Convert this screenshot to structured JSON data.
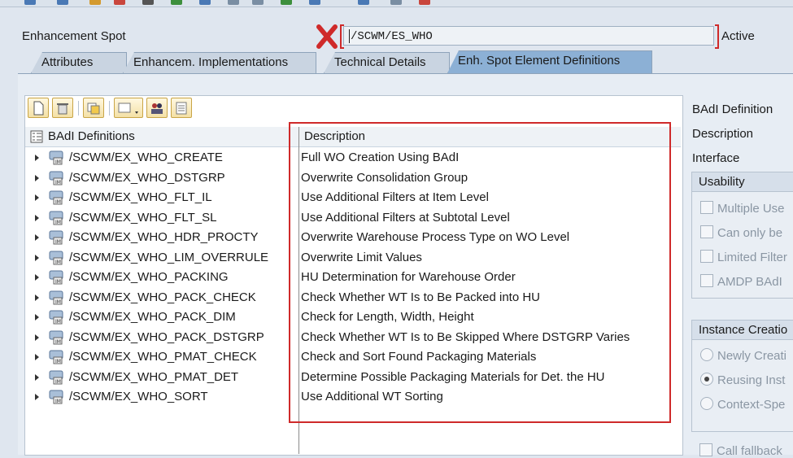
{
  "header": {
    "spot_label": "Enhancement Spot",
    "spot_value": "/SCWM/ES_WHO",
    "status": "Active"
  },
  "tabs": [
    {
      "label": "Attributes"
    },
    {
      "label": "Enhancem. Implementations"
    },
    {
      "label": "Technical Details"
    },
    {
      "label": "Enh. Spot Element Definitions"
    }
  ],
  "table": {
    "col_name": "BAdI Definitions",
    "col_desc": "Description",
    "rows": [
      {
        "name": "/SCWM/EX_WHO_CREATE",
        "desc": "Full WO Creation Using BAdI"
      },
      {
        "name": "/SCWM/EX_WHO_DSTGRP",
        "desc": "Overwrite Consolidation Group"
      },
      {
        "name": "/SCWM/EX_WHO_FLT_IL",
        "desc": "Use Additional Filters at Item Level"
      },
      {
        "name": "/SCWM/EX_WHO_FLT_SL",
        "desc": "Use Additional Filters at Subtotal Level"
      },
      {
        "name": "/SCWM/EX_WHO_HDR_PROCTY",
        "desc": "Overwrite Warehouse Process Type on WO Level"
      },
      {
        "name": "/SCWM/EX_WHO_LIM_OVERRULE",
        "desc": "Overwrite Limit Values"
      },
      {
        "name": "/SCWM/EX_WHO_PACKING",
        "desc": "HU Determination for Warehouse Order"
      },
      {
        "name": "/SCWM/EX_WHO_PACK_CHECK",
        "desc": "Check Whether WT Is to Be Packed into HU"
      },
      {
        "name": "/SCWM/EX_WHO_PACK_DIM",
        "desc": "Check for Length, Width, Height"
      },
      {
        "name": "/SCWM/EX_WHO_PACK_DSTGRP",
        "desc": "Check Whether WT Is to Be Skipped Where DSTGRP Varies"
      },
      {
        "name": "/SCWM/EX_WHO_PMAT_CHECK",
        "desc": "Check and Sort Found Packaging Materials"
      },
      {
        "name": "/SCWM/EX_WHO_PMAT_DET",
        "desc": "Determine Possible Packaging Materials for Det. the HU"
      },
      {
        "name": "/SCWM/EX_WHO_SORT",
        "desc": "Use Additional WT Sorting"
      }
    ]
  },
  "side": {
    "badi_def": "BAdI Definition",
    "description": "Description",
    "interface": "Interface",
    "usability_title": "Usability",
    "usability": [
      {
        "label": "Multiple Use"
      },
      {
        "label": "Can only be"
      },
      {
        "label": "Limited Filter"
      },
      {
        "label": "AMDP BAdI"
      }
    ],
    "instance_title": "Instance Creatio",
    "instance": [
      {
        "label": "Newly Creati",
        "selected": false
      },
      {
        "label": "Reusing Inst",
        "selected": true
      },
      {
        "label": "Context-Spe",
        "selected": false
      }
    ],
    "fallback": "Call fallback"
  },
  "icons": {
    "error_mark": "red-x-icon",
    "badi": "badi-definition-icon",
    "tree_header": "tree-header-icon"
  },
  "colors": {
    "highlight": "#cf2a2a",
    "active_tab": "#8cb0d5"
  }
}
